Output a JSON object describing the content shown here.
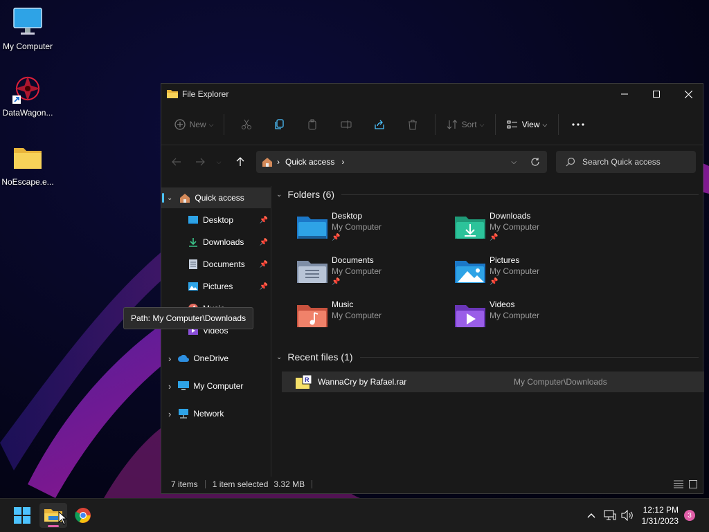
{
  "desktop": {
    "icons": [
      {
        "label": "My Computer",
        "icon": "monitor-icon"
      },
      {
        "label": "DataWagon...",
        "icon": "datawagon-shortcut-icon"
      },
      {
        "label": "NoEscape.e...",
        "icon": "folder-icon"
      }
    ]
  },
  "window": {
    "title": "File Explorer",
    "controls": {
      "minimize": "minimize-icon",
      "maximize": "maximize-icon",
      "close": "close-icon"
    }
  },
  "toolbar": {
    "new_label": "New",
    "sort_label": "Sort",
    "view_label": "View",
    "more_icon": "more-icon"
  },
  "address": {
    "location": "Quick access",
    "search_placeholder": "Search Quick access"
  },
  "sidebar": {
    "quick_access": "Quick access",
    "pinned": [
      {
        "label": "Desktop",
        "pinned": true
      },
      {
        "label": "Downloads",
        "pinned": true
      },
      {
        "label": "Documents",
        "pinned": true
      },
      {
        "label": "Pictures",
        "pinned": true
      },
      {
        "label": "Music",
        "pinned": false
      },
      {
        "label": "Videos",
        "pinned": false
      }
    ],
    "roots": [
      {
        "label": "OneDrive"
      },
      {
        "label": "My Computer"
      },
      {
        "label": "Network"
      }
    ]
  },
  "content": {
    "folders_heading": "Folders (6)",
    "folders": [
      {
        "name": "Desktop",
        "location": "My Computer",
        "pinned": true
      },
      {
        "name": "Downloads",
        "location": "My Computer",
        "pinned": true
      },
      {
        "name": "Documents",
        "location": "My Computer",
        "pinned": true
      },
      {
        "name": "Pictures",
        "location": "My Computer",
        "pinned": true
      },
      {
        "name": "Music",
        "location": "My Computer",
        "pinned": false
      },
      {
        "name": "Videos",
        "location": "My Computer",
        "pinned": false
      }
    ],
    "recent_heading": "Recent files (1)",
    "recent": [
      {
        "name": "WannaCry by Rafael.rar",
        "path": "My Computer\\Downloads"
      }
    ],
    "tooltip": "Path: My Computer\\Downloads"
  },
  "status": {
    "items": "7 items",
    "selected": "1 item selected",
    "size": "3.32 MB"
  },
  "taskbar": {
    "time": "12:12 PM",
    "date": "1/31/2023",
    "notifications": "3"
  },
  "colors": {
    "accent": "#4cc2ff",
    "window_bg": "#191919",
    "taskbar_bg": "#1c1c1c"
  }
}
